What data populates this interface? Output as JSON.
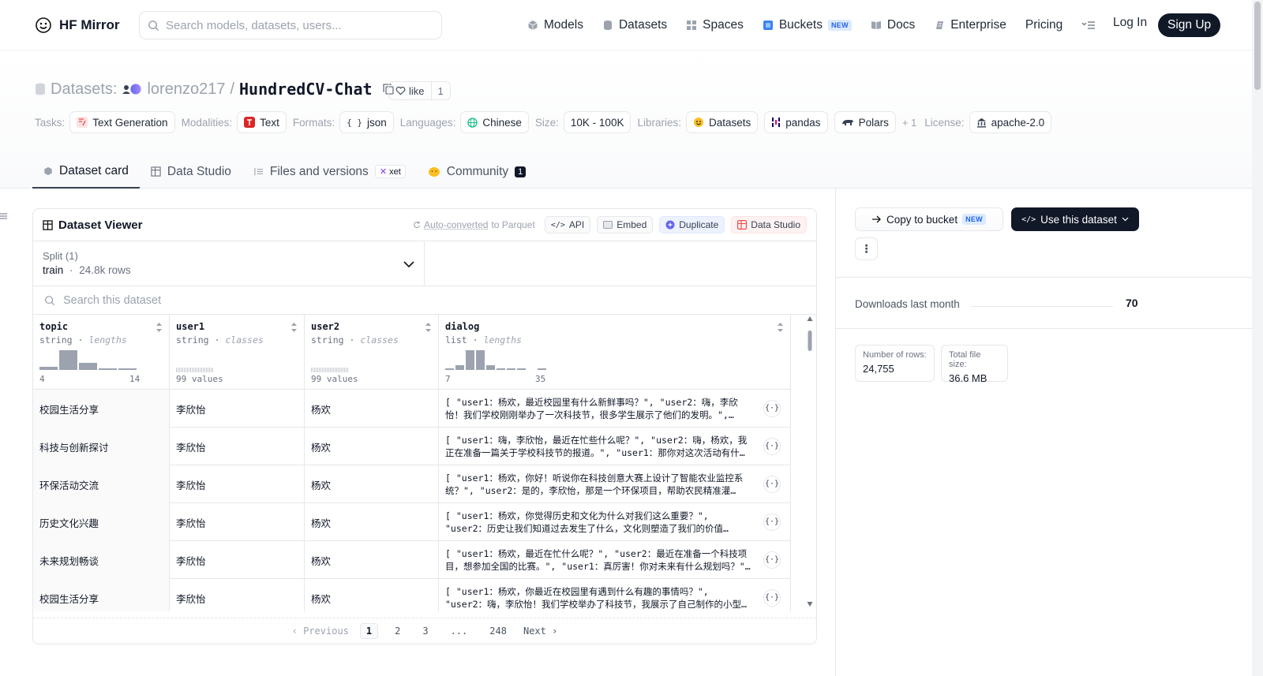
{
  "nav": {
    "brand": "HF Mirror",
    "search_placeholder": "Search models, datasets, users...",
    "links": [
      {
        "label": "Models",
        "icon": "cube-icon"
      },
      {
        "label": "Datasets",
        "icon": "database-icon"
      },
      {
        "label": "Spaces",
        "icon": "grid-icon"
      },
      {
        "label": "Buckets",
        "icon": "bucket-icon",
        "badge": "NEW"
      },
      {
        "label": "Docs",
        "icon": "book-icon"
      },
      {
        "label": "Enterprise",
        "icon": "enterprise-icon"
      },
      {
        "label": "Pricing"
      }
    ],
    "login": "Log In",
    "signup": "Sign Up"
  },
  "repo": {
    "type_label": "Datasets:",
    "owner": "lorenzo217",
    "separator": "/",
    "name": "HundredCV-Chat",
    "like_label": "like",
    "like_count": "1"
  },
  "tags": {
    "tasks_label": "Tasks:",
    "task": "Text Generation",
    "modalities_label": "Modalities:",
    "modality": "Text",
    "formats_label": "Formats:",
    "format": "json",
    "languages_label": "Languages:",
    "language": "Chinese",
    "size_label": "Size:",
    "size": "10K - 100K",
    "libraries_label": "Libraries:",
    "libraries": [
      "Datasets",
      "pandas",
      "Polars"
    ],
    "libraries_more": "+ 1",
    "license_label": "License:",
    "license": "apache-2.0"
  },
  "tabs": [
    {
      "label": "Dataset card"
    },
    {
      "label": "Data Studio"
    },
    {
      "label": "Files and versions",
      "badge": "xet"
    },
    {
      "label": "Community",
      "count": "1"
    }
  ],
  "viewer": {
    "title": "Dataset Viewer",
    "auto_converted": "Auto-converted",
    "auto_suffix": "to Parquet",
    "buttons": {
      "api": "API",
      "embed": "Embed",
      "duplicate": "Duplicate",
      "data_studio": "Data Studio"
    },
    "split_label": "Split (1)",
    "split_name": "train",
    "split_sep": "·",
    "split_rows": "24.8k rows",
    "search_placeholder": "Search this dataset",
    "columns": [
      {
        "name": "topic",
        "type": "string",
        "stat": "lengths",
        "min": "4",
        "max": "14",
        "hist": [
          0.15,
          0.85,
          0.3,
          0.05,
          0.05
        ]
      },
      {
        "name": "user1",
        "type": "string",
        "stat": "classes",
        "values": "99 values"
      },
      {
        "name": "user2",
        "type": "string",
        "stat": "classes",
        "values": "99 values"
      },
      {
        "name": "dialog",
        "type": "list",
        "stat": "lengths",
        "min": "7",
        "max": "35",
        "hist": [
          0.05,
          0.2,
          0.85,
          0.85,
          0.2,
          0.05,
          0.05,
          0.05,
          0,
          0.05
        ]
      }
    ],
    "type_sep": "·",
    "rows": [
      {
        "topic": "校园生活分享",
        "user1": "李欣怡",
        "user2": "杨欢",
        "dialog": "[ \"user1：杨欢，最近校园里有什么新鲜事吗？\", \"user2：嗨，李欣怡！我们学校刚刚举办了一次科技节，很多学生展示了他们的发明。\",…"
      },
      {
        "topic": "科技与创新探讨",
        "user1": "李欣怡",
        "user2": "杨欢",
        "dialog": "[ \"user1：嗨，李欣怡，最近在忙些什么呢？\", \"user2：嗨，杨欢，我正在准备一篇关于学校科技节的报道。\", \"user1：那你对这次活动有什…"
      },
      {
        "topic": "环保活动交流",
        "user1": "李欣怡",
        "user2": "杨欢",
        "dialog": "[ \"user1：杨欢，你好！听说你在科技创意大赛上设计了智能农业监控系统？\", \"user2：是的，李欣怡，那是一个环保项目，帮助农民精准灌…"
      },
      {
        "topic": "历史文化兴趣",
        "user1": "李欣怡",
        "user2": "杨欢",
        "dialog": "[ \"user1：杨欢，你觉得历史和文化为什么对我们这么重要？\", \"user2：历史让我们知道过去发生了什么，文化则塑造了我们的价值…"
      },
      {
        "topic": "未来规划畅谈",
        "user1": "李欣怡",
        "user2": "杨欢",
        "dialog": "[ \"user1：杨欢，最近在忙什么呢？\", \"user2：最近在准备一个科技项目，想参加全国的比赛。\", \"user1：真厉害！你对未来有什么规划吗？\"…"
      },
      {
        "topic": "校园生活分享",
        "user1": "李欣怡",
        "user2": "杨欢",
        "dialog": "[ \"user1：杨欢，你最近在校园里有遇到什么有趣的事情吗？\", \"user2：嗨，李欣怡！我们学校举办了科技节，我展示了自己制作的小型…"
      }
    ],
    "json_icon_label": "{·}",
    "pager": {
      "prev": "‹ Previous",
      "pages": [
        "1",
        "2",
        "3",
        "...",
        "248"
      ],
      "next": "Next ›"
    }
  },
  "side": {
    "copy_label": "Copy to bucket",
    "copy_badge": "NEW",
    "use_label": "Use this dataset",
    "more_label": "⋮",
    "downloads_label": "Downloads last month",
    "downloads_value": "70",
    "rows_label": "Number of rows:",
    "rows_value": "24,755",
    "size_label": "Total file size:",
    "size_value": "36.6 MB"
  }
}
